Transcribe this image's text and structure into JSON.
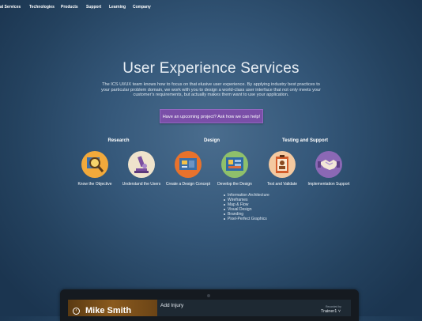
{
  "nav": {
    "items": [
      "al Services",
      "Technologies",
      "Products",
      "Support",
      "Learning",
      "Company"
    ]
  },
  "hero": {
    "title": "User Experience Services",
    "description": "The ICS UI/UX team knows how to focus on that elusive user experience. By applying industry best practices to your particular problem domain, we work with you to design a world-class user interface that not only meets your customer's requirements, but actually makes them want to use your application.",
    "cta_label": "Have an upcoming project? Ask how we can help!"
  },
  "sections": {
    "research": "Research",
    "design": "Design",
    "testing": "Testing and Support"
  },
  "steps": [
    {
      "label": "Know the Objective",
      "icon": "magnifier-icon",
      "color": "#f2a93b"
    },
    {
      "label": "Understand the Users",
      "icon": "microscope-icon",
      "color": "#efe3cc"
    },
    {
      "label": "Create a Design Concept",
      "icon": "design-board-icon",
      "color": "#e8722c"
    },
    {
      "label": "Develop the Design",
      "icon": "blueprint-icon",
      "color": "#8fc06b"
    },
    {
      "label": "Test and Validate",
      "icon": "clipboard-person-icon",
      "color": "#f4c9a0"
    },
    {
      "label": "Implementation Support",
      "icon": "handshake-icon",
      "color": "#8b68b5"
    }
  ],
  "design_items": [
    "Information Architecture",
    "Wireframes",
    "Map & Flow",
    "Visual Design",
    "Branding",
    "Pixel-Perfect Graphics"
  ],
  "device": {
    "profile_name": "Mike Smith",
    "app_title": "Add Injury",
    "recorded_by": "Recorded by",
    "trainer": "Trainer1"
  }
}
